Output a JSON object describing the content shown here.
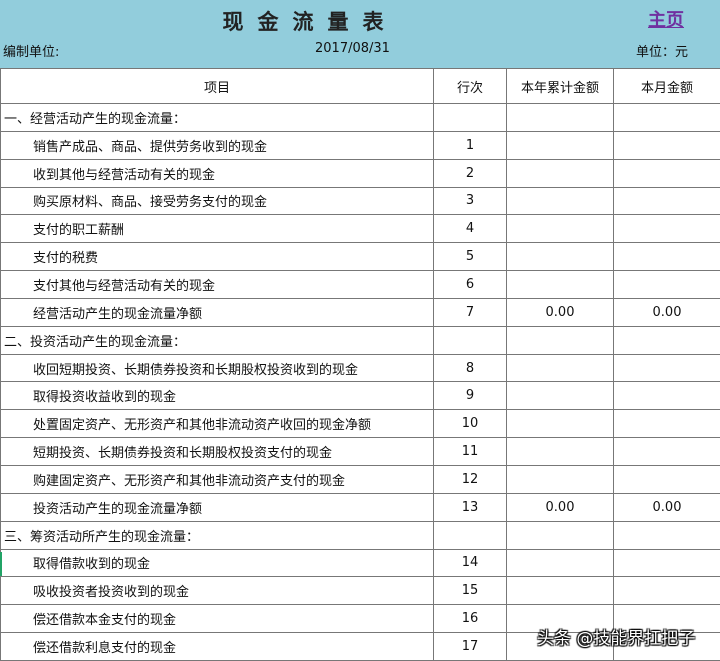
{
  "header": {
    "title": "现金流量表",
    "home_link": "主页",
    "org_label": "编制单位:",
    "date": "2017/08/31",
    "unit": "单位：元"
  },
  "columns": [
    "项目",
    "行次",
    "本年累计金额",
    "本月金额"
  ],
  "rows": [
    {
      "item": "一、经营活动产生的现金流量：",
      "section": true,
      "line": "",
      "ytd": "",
      "month": ""
    },
    {
      "item": "销售产成品、商品、提供劳务收到的现金",
      "line": "1",
      "ytd": "",
      "month": ""
    },
    {
      "item": "收到其他与经营活动有关的现金",
      "line": "2",
      "ytd": "",
      "month": ""
    },
    {
      "item": "购买原材料、商品、接受劳务支付的现金",
      "line": "3",
      "ytd": "",
      "month": ""
    },
    {
      "item": "支付的职工薪酬",
      "line": "4",
      "ytd": "",
      "month": ""
    },
    {
      "item": "支付的税费",
      "line": "5",
      "ytd": "",
      "month": ""
    },
    {
      "item": "支付其他与经营活动有关的现金",
      "line": "6",
      "ytd": "",
      "month": ""
    },
    {
      "item": "经营活动产生的现金流量净额",
      "line": "7",
      "ytd": "0.00",
      "month": "0.00"
    },
    {
      "item": "二、投资活动产生的现金流量：",
      "section": true,
      "line": "",
      "ytd": "",
      "month": ""
    },
    {
      "item": "收回短期投资、长期债券投资和长期股权投资收到的现金",
      "line": "8",
      "ytd": "",
      "month": ""
    },
    {
      "item": "取得投资收益收到的现金",
      "line": "9",
      "ytd": "",
      "month": ""
    },
    {
      "item": "处置固定资产、无形资产和其他非流动资产收回的现金净额",
      "line": "10",
      "ytd": "",
      "month": ""
    },
    {
      "item": "短期投资、长期债券投资和长期股权投资支付的现金",
      "line": "11",
      "ytd": "",
      "month": ""
    },
    {
      "item": "购建固定资产、无形资产和其他非流动资产支付的现金",
      "line": "12",
      "ytd": "",
      "month": ""
    },
    {
      "item": "投资活动产生的现金流量净额",
      "line": "13",
      "ytd": "0.00",
      "month": "0.00"
    },
    {
      "item": "三、筹资活动所产生的现金流量：",
      "section": true,
      "line": "",
      "ytd": "",
      "month": ""
    },
    {
      "item": "取得借款收到的现金",
      "line": "14",
      "ytd": "",
      "month": ""
    },
    {
      "item": "吸收投资者投资收到的现金",
      "line": "15",
      "ytd": "",
      "month": ""
    },
    {
      "item": "偿还借款本金支付的现金",
      "line": "16",
      "ytd": "",
      "month": ""
    },
    {
      "item": "偿还借款利息支付的现金",
      "line": "17",
      "ytd": "",
      "month": ""
    }
  ],
  "watermark": "头条 @技能界扛把子"
}
